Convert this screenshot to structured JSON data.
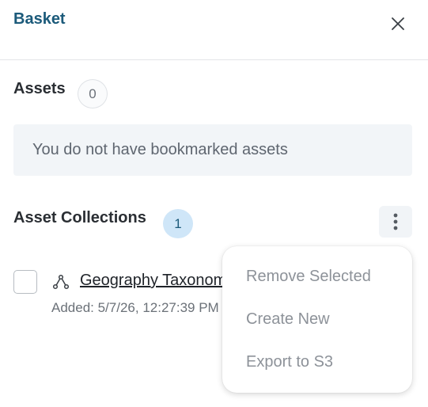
{
  "header": {
    "title": "Basket",
    "close_icon": "close-icon"
  },
  "assets": {
    "title": "Assets",
    "count": "0",
    "empty_message": "You do not have bookmarked assets"
  },
  "collections": {
    "title": "Asset Collections",
    "count": "1",
    "menu_icon": "more-vertical-icon",
    "items": [
      {
        "icon": "collection-graph-icon",
        "name": "Geography Taxonomy",
        "added": "Added: 5/7/26, 12:27:39 PM"
      }
    ]
  },
  "menu": {
    "items": [
      "Remove Selected",
      "Create New",
      "Export to S3"
    ]
  },
  "colors": {
    "accent": "#1b5a7a",
    "badge_bg": "#cfe6f8",
    "menu_text": "#8d9299"
  }
}
